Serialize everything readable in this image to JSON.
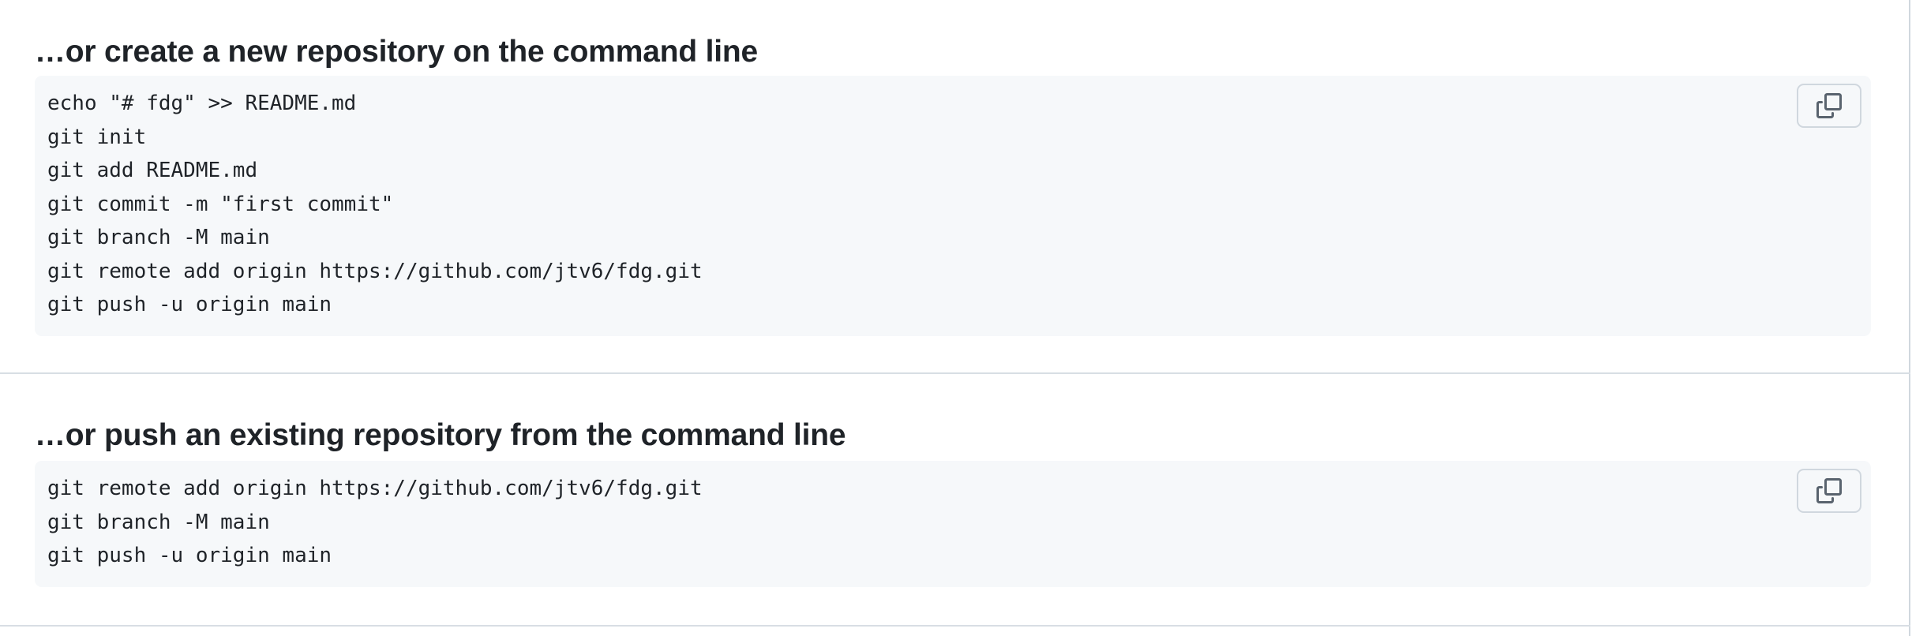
{
  "sections": [
    {
      "title": "…or create a new repository on the command line",
      "lines": [
        "echo \"# fdg\" >> README.md",
        "git init",
        "git add README.md",
        "git commit -m \"first commit\"",
        "git branch -M main",
        "git remote add origin https://github.com/jtv6/fdg.git",
        "git push -u origin main"
      ],
      "copy_icon": "copy-icon"
    },
    {
      "title": "…or push an existing repository from the command line",
      "lines": [
        "git remote add origin https://github.com/jtv6/fdg.git",
        "git branch -M main",
        "git push -u origin main"
      ],
      "copy_icon": "copy-icon"
    }
  ],
  "colors": {
    "code_background": "#f6f8fa",
    "border": "#d0d7de",
    "text": "#1f2328",
    "icon": "#59636e"
  }
}
